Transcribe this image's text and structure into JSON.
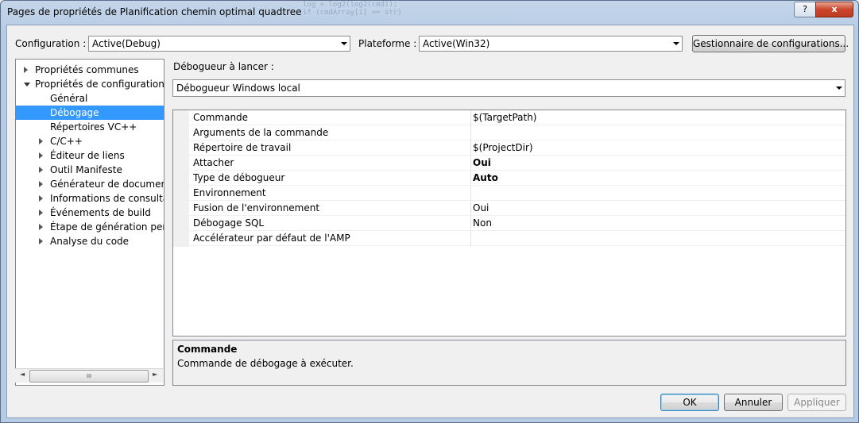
{
  "window": {
    "title": "Pages de propriétés de Planification chemin optimal quadtree",
    "help_glyph": "?",
    "close_glyph": "x",
    "bg_code": [
      "log = log2(log2(cmd));",
      "if (cmdArray[i] == str)"
    ]
  },
  "toolbar": {
    "configuration_label": "Configuration :",
    "configuration_value": "Active(Debug)",
    "platform_label": "Plateforme :",
    "platform_value": "Active(Win32)",
    "config_manager_label": "Gestionnaire de configurations..."
  },
  "tree": {
    "items": [
      {
        "label": "Propriétés communes",
        "expander": "closed",
        "indent": 0
      },
      {
        "label": "Propriétés de configuration",
        "expander": "open",
        "indent": 0
      },
      {
        "label": "Général",
        "expander": "none",
        "indent": 1
      },
      {
        "label": "Débogage",
        "expander": "none",
        "indent": 1,
        "selected": true
      },
      {
        "label": "Répertoires VC++",
        "expander": "none",
        "indent": 1
      },
      {
        "label": "C/C++",
        "expander": "closed",
        "indent": 1
      },
      {
        "label": "Éditeur de liens",
        "expander": "closed",
        "indent": 1
      },
      {
        "label": "Outil Manifeste",
        "expander": "closed",
        "indent": 1
      },
      {
        "label": "Générateur de document X",
        "expander": "closed",
        "indent": 1
      },
      {
        "label": "Informations de consultati",
        "expander": "closed",
        "indent": 1
      },
      {
        "label": "Événements de build",
        "expander": "closed",
        "indent": 1
      },
      {
        "label": "Étape de génération perso",
        "expander": "closed",
        "indent": 1
      },
      {
        "label": "Analyse du code",
        "expander": "closed",
        "indent": 1
      }
    ],
    "scroll_left": "◄",
    "scroll_right": "►",
    "scroll_grip": "III"
  },
  "debugger": {
    "label": "Débogueur à lancer :",
    "value": "Débogueur Windows local"
  },
  "properties": [
    {
      "name": "Commande",
      "value": "$(TargetPath)",
      "bold": false
    },
    {
      "name": "Arguments de la commande",
      "value": "",
      "bold": false
    },
    {
      "name": "Répertoire de travail",
      "value": "$(ProjectDir)",
      "bold": false
    },
    {
      "name": "Attacher",
      "value": "Oui",
      "bold": true
    },
    {
      "name": "Type de débogueur",
      "value": "Auto",
      "bold": true
    },
    {
      "name": "Environnement",
      "value": "",
      "bold": false
    },
    {
      "name": "Fusion de l'environnement",
      "value": "Oui",
      "bold": false
    },
    {
      "name": "Débogage SQL",
      "value": "Non",
      "bold": false
    },
    {
      "name": "Accélérateur par défaut de l'AMP",
      "value": "",
      "bold": false
    }
  ],
  "description": {
    "title": "Commande",
    "text": "Commande de débogage à exécuter."
  },
  "buttons": {
    "ok": "OK",
    "cancel": "Annuler",
    "apply": "Appliquer"
  },
  "colors": {
    "selection": "#3399ff",
    "title_gradient_top": "#c5d6ea",
    "close_button": "#c9452b"
  }
}
